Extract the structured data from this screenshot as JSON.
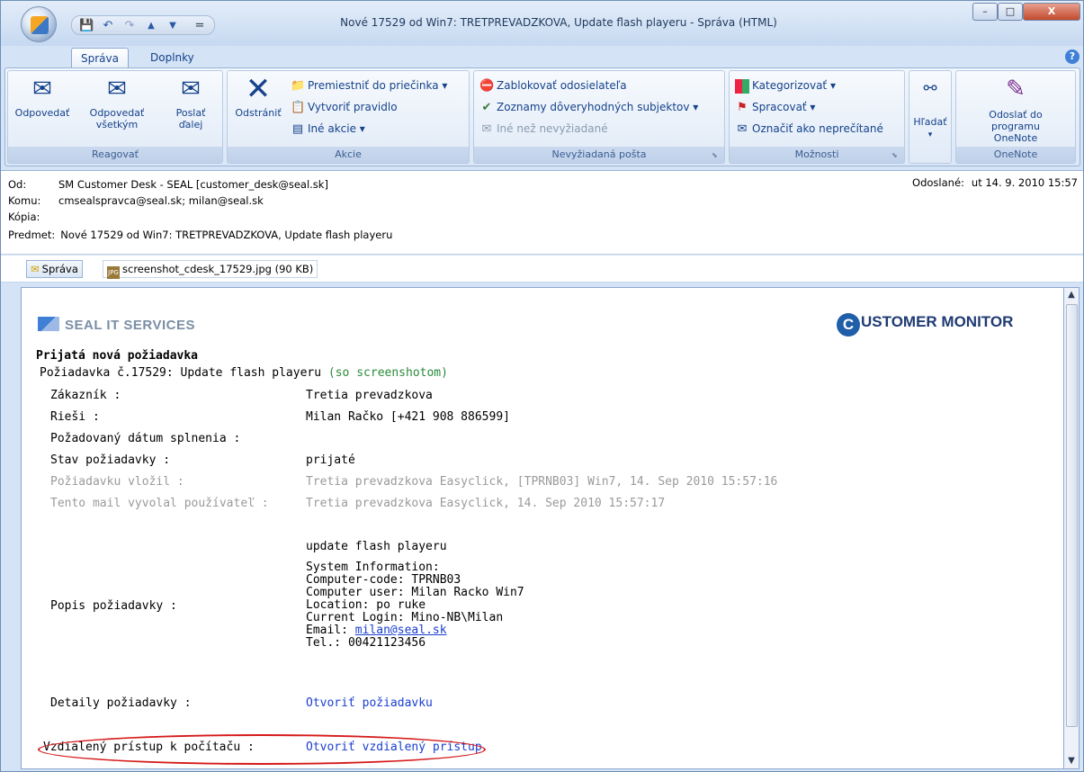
{
  "window": {
    "title": "Nové 17529 od Win7: TRETPREVADZKOVA, Update flash playeru - Správa (HTML)",
    "min": "–",
    "max": "□",
    "close": "X"
  },
  "quick_access": {
    "save": "💾",
    "undo": "↶",
    "redo": "↷",
    "up": "▲",
    "down": "▼",
    "more": "="
  },
  "tabs": [
    "Správa",
    "Doplnky"
  ],
  "ribbon": {
    "reagovat": {
      "label": "Reagovať",
      "buttons": [
        "Odpovedať",
        "Odpovedať všetkým",
        "Poslať ďalej"
      ]
    },
    "akcie": {
      "label": "Akcie",
      "delete": "Odstrániť",
      "move": "Premiestniť do priečinka ▾",
      "rule": "Vytvoriť pravidlo",
      "other": "Iné akcie ▾"
    },
    "nevyziadana": {
      "label": "Nevyžiadaná pošta",
      "block": "Zablokovať odosielateľa",
      "trusted": "Zoznamy dôveryhodných subjektov ▾",
      "notjunk": "Iné než nevyžiadané"
    },
    "moznosti": {
      "label": "Možnosti",
      "categorize": "Kategorizovať ▾",
      "followup": "Spracovať ▾",
      "unread": "Označiť ako neprečítané"
    },
    "find": {
      "label": "Hľadať",
      "arrow": "▾"
    },
    "onenote": {
      "label": "OneNote",
      "button": "Odoslať do programu OneNote"
    }
  },
  "header": {
    "from_label": "Od:",
    "from": "SM Customer Desk - SEAL [customer_desk@seal.sk]",
    "to_label": "Komu:",
    "to": "cmsealspravca@seal.sk; milan@seal.sk",
    "cc_label": "Kópia:",
    "cc": "",
    "subject_label": "Predmet:",
    "subject": "Nové 17529 od Win7: TRETPREVADZKOVA, Update flash playeru",
    "sent_label": "Odoslané:",
    "sent": "ut 14. 9. 2010 15:57"
  },
  "attachments": {
    "message": "Správa",
    "file": "screenshot_cdesk_17529.jpg (90 KB)"
  },
  "email": {
    "seal_logo": "SEAL IT SERVICES",
    "cm_logo_letter": "C",
    "cm_logo_rest": "USTOMER MONITOR",
    "heading": "Prijatá nová požiadavka",
    "request_prefix": "Požiadavka č.17529:  Update flash playeru",
    "request_note": "(so screenshotom)",
    "rows": [
      {
        "label": "Zákazník :",
        "value": "Tretia prevadzkova"
      },
      {
        "label": "Rieši :",
        "value": "Milan Račko  [+421 908 886599]"
      },
      {
        "label": "Požadovaný dátum splnenia :",
        "value": ""
      },
      {
        "label": "Stav požiadavky :",
        "value": "prijaté"
      },
      {
        "label": "Požiadavku vložil :",
        "value": "Tretia prevadzkova Easyclick, [TPRNB03] Win7, 14. Sep 2010 15:57:16"
      },
      {
        "label": "Tento mail vyvolal používateľ :",
        "value": "Tretia prevadzkova Easyclick, 14. Sep 2010 15:57:17"
      }
    ],
    "desc_label": "Popis požiadavky :",
    "desc_title": "update flash playeru",
    "desc_lines": [
      "System Information:",
      "Computer-code: TPRNB03",
      "Computer user: Milan Racko Win7",
      "Location: po ruke",
      "Current Login: Mino-NB\\Milan"
    ],
    "email_prefix": "Email: ",
    "email_link": "milan@seal.sk",
    "tel": "Tel.: 00421123456",
    "details_label": "Detaily požiadavky :",
    "details_link": "Otvoriť požiadavku",
    "remote_label": "Vzdialený prístup k počítaču :",
    "remote_link": "Otvoriť vzdialený prístup"
  }
}
